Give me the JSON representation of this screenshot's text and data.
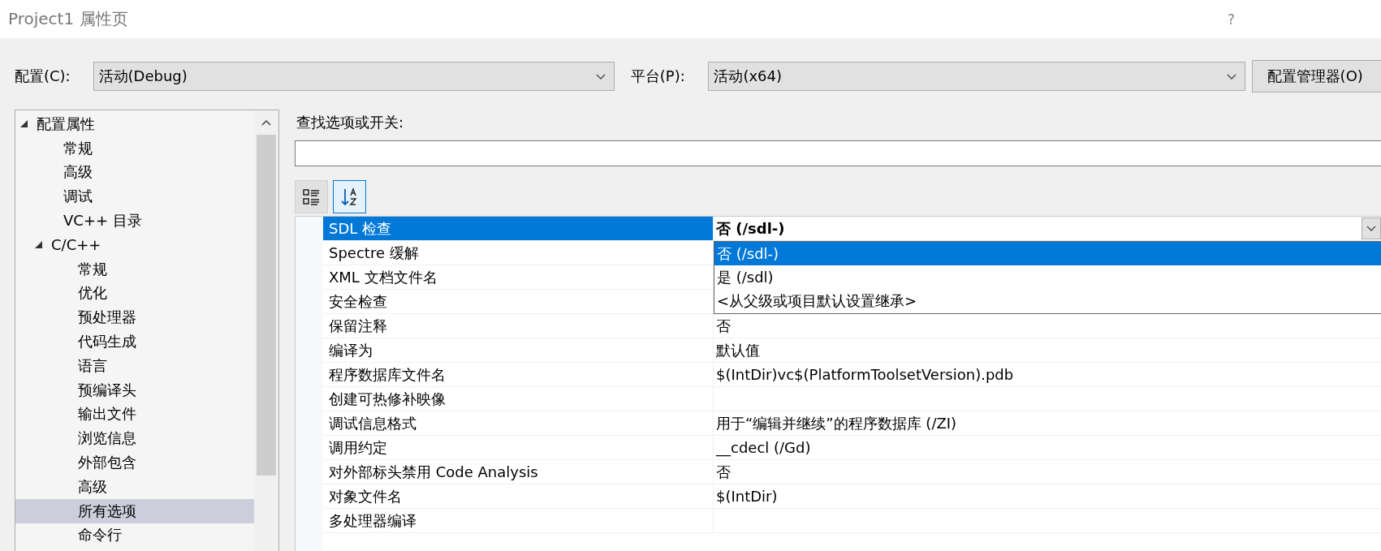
{
  "window": {
    "title": "Project1 属性页",
    "help": "?"
  },
  "configuration": {
    "label": "配置(C):",
    "value": "活动(Debug)"
  },
  "platform": {
    "label": "平台(P):",
    "value": "活动(x64)"
  },
  "config_manager_button": "配置管理器(O)",
  "tree": [
    {
      "label": "配置属性",
      "expanded": true,
      "selected": false,
      "children": [
        {
          "label": "常规",
          "selected": false
        },
        {
          "label": "高级",
          "selected": false
        },
        {
          "label": "调试",
          "selected": false
        },
        {
          "label": "VC++ 目录",
          "selected": false
        },
        {
          "label": "C/C++",
          "expanded": true,
          "selected": false,
          "children": [
            {
              "label": "常规",
              "selected": false
            },
            {
              "label": "优化",
              "selected": false
            },
            {
              "label": "预处理器",
              "selected": false
            },
            {
              "label": "代码生成",
              "selected": false
            },
            {
              "label": "语言",
              "selected": false
            },
            {
              "label": "预编译头",
              "selected": false
            },
            {
              "label": "输出文件",
              "selected": false
            },
            {
              "label": "浏览信息",
              "selected": false
            },
            {
              "label": "外部包含",
              "selected": false
            },
            {
              "label": "高级",
              "selected": false
            },
            {
              "label": "所有选项",
              "selected": true
            },
            {
              "label": "命令行",
              "selected": false
            }
          ]
        }
      ]
    }
  ],
  "search": {
    "label": "查找选项或开关:"
  },
  "toolbar": [
    {
      "kind": "categorized",
      "selected": false
    },
    {
      "kind": "alphabetical",
      "selected": true
    }
  ],
  "grid": {
    "rows": [
      {
        "name": "SDL 检查",
        "value": "否 (/sdl-)",
        "selected": true
      },
      {
        "name": "Spectre 缓解",
        "selected": false
      },
      {
        "name": "XML 文档文件名",
        "selected": false
      },
      {
        "name": "安全检查",
        "selected": false
      },
      {
        "name": "保留注释",
        "value": "否",
        "selected": false
      },
      {
        "name": "编译为",
        "value": "默认值",
        "selected": false
      },
      {
        "name": "程序数据库文件名",
        "value": "$(IntDir)vc$(PlatformToolsetVersion).pdb",
        "selected": false
      },
      {
        "name": "创建可热修补映像",
        "selected": false
      },
      {
        "name": "调试信息格式",
        "value": "用于“编辑并继续”的程序数据库 (/ZI)",
        "selected": false
      },
      {
        "name": "调用约定",
        "value": "__cdecl (/Gd)",
        "selected": false
      },
      {
        "name": "对外部标头禁用 Code Analysis",
        "value": "否",
        "selected": false
      },
      {
        "name": "对象文件名",
        "value": "$(IntDir)",
        "selected": false
      },
      {
        "name": "多处理器编译",
        "selected": false
      }
    ]
  },
  "dropdown": {
    "options": [
      {
        "label": "否 (/sdl-)",
        "selected": true
      },
      {
        "label": "是 (/sdl)",
        "selected": false
      },
      {
        "label": "<从父级或项目默认设置继承>",
        "selected": false
      }
    ]
  }
}
